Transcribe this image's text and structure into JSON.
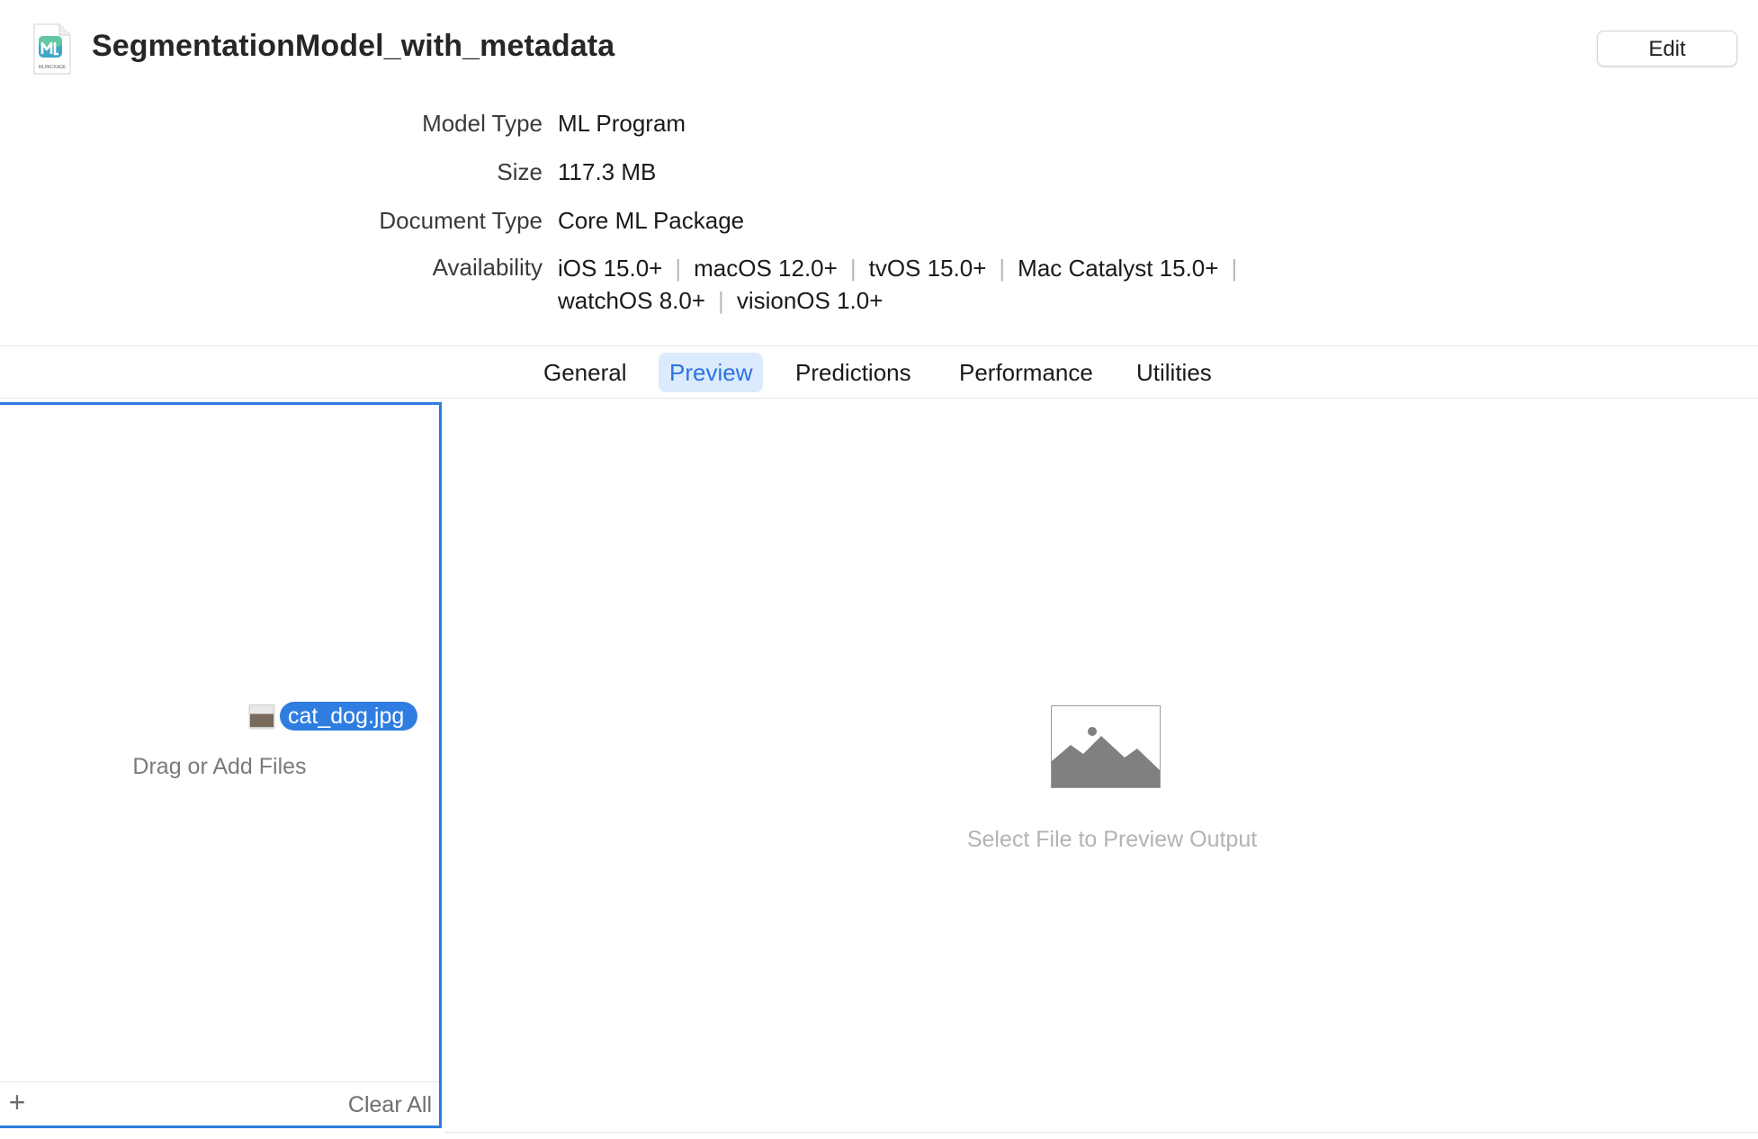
{
  "header": {
    "file_icon_caption": "MLPACKAGE",
    "title": "SegmentationModel_with_metadata",
    "edit_label": "Edit"
  },
  "info": {
    "model_type": {
      "label": "Model Type",
      "value": "ML Program"
    },
    "size": {
      "label": "Size",
      "value": "117.3 MB"
    },
    "document_type": {
      "label": "Document Type",
      "value": "Core ML Package"
    },
    "availability": {
      "label": "Availability",
      "platforms": [
        "iOS 15.0+",
        "macOS 12.0+",
        "tvOS 15.0+",
        "Mac Catalyst 15.0+",
        "watchOS 8.0+",
        "visionOS 1.0+"
      ],
      "separator": "|"
    }
  },
  "tabs": [
    {
      "label": "General"
    },
    {
      "label": "Preview"
    },
    {
      "label": "Predictions"
    },
    {
      "label": "Performance"
    },
    {
      "label": "Utilities"
    }
  ],
  "active_tab": "Preview",
  "drop_panel": {
    "dragged_file": "cat_dog.jpg",
    "hint": "Drag or Add Files",
    "add_symbol": "+",
    "clear_all": "Clear All"
  },
  "preview": {
    "placeholder_text": "Select File to Preview Output"
  },
  "colors": {
    "accent": "#2f7de1",
    "active_tab_bg": "#dceafd",
    "active_tab_text": "#2a74e0",
    "muted_text": "#7a7a7a",
    "placeholder_text": "#b3b3b3"
  }
}
